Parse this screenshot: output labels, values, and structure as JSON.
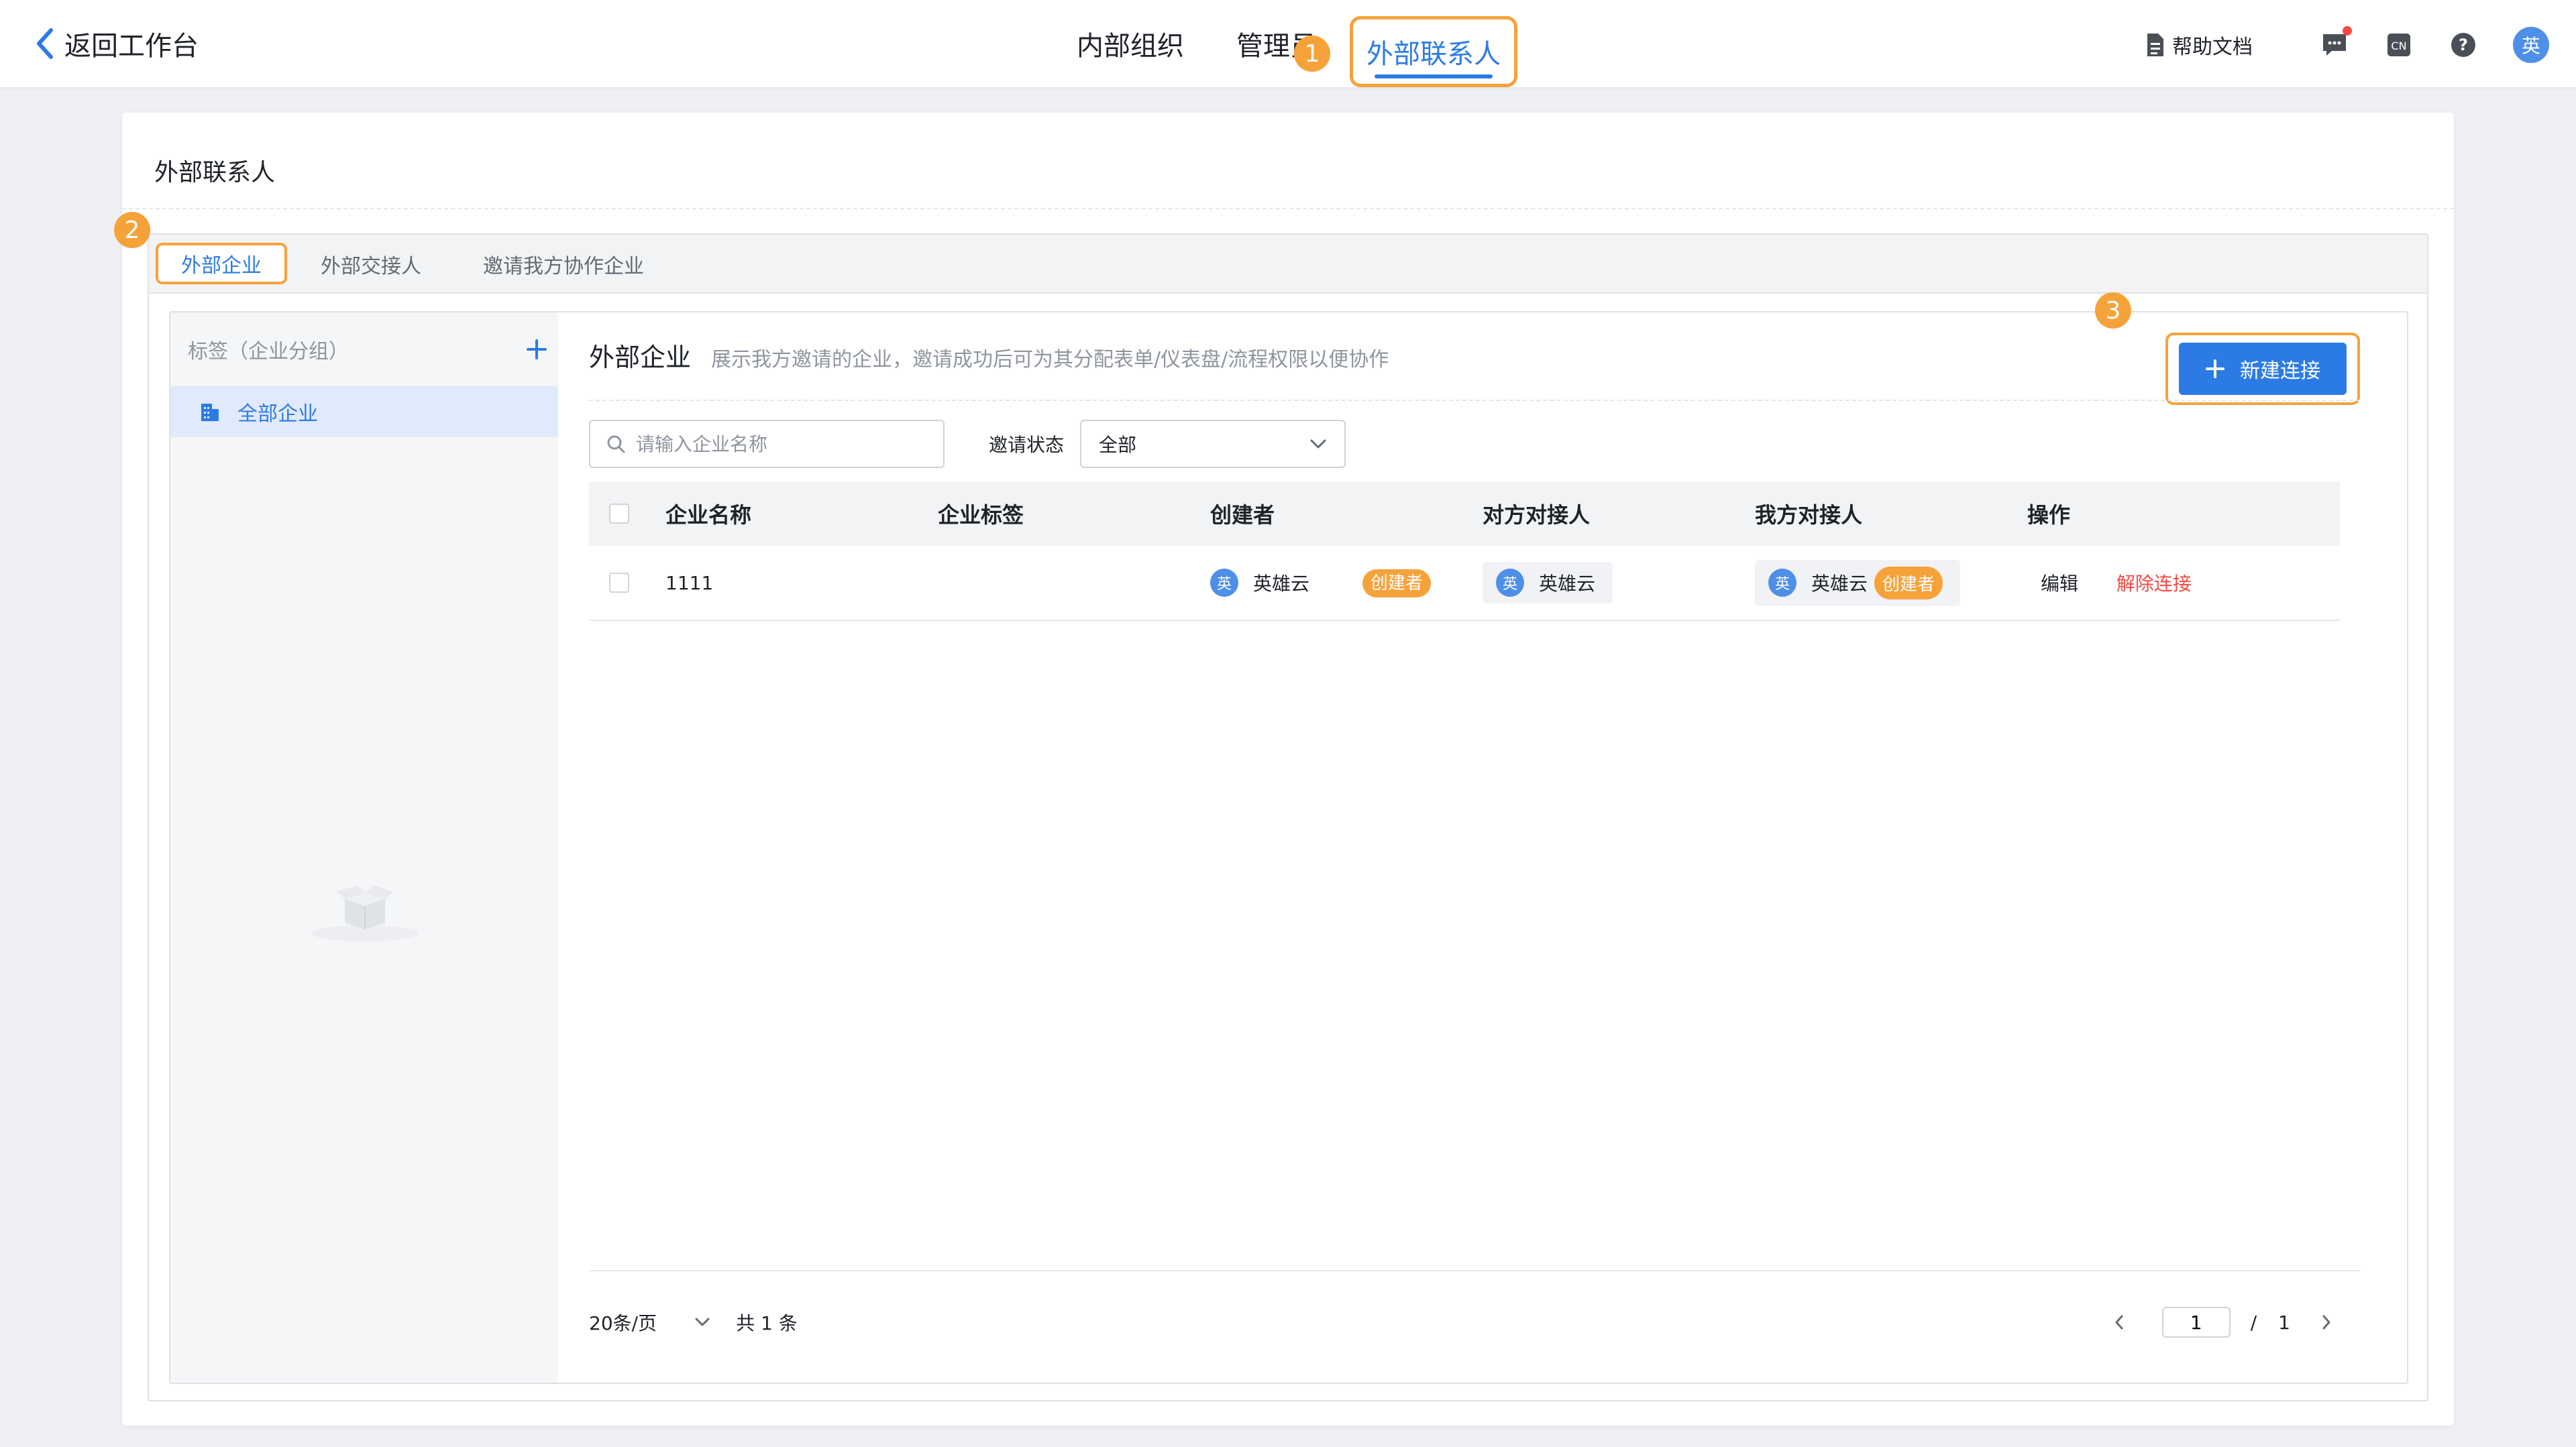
{
  "topbar": {
    "back_label": "返回工作台",
    "nav": {
      "internal": "内部组织",
      "admin": "管理员",
      "external": "外部联系人"
    },
    "help_doc": "帮助文档",
    "lang_icon_text": "CN",
    "help_icon_text": "?",
    "avatar_text": "英"
  },
  "badges": {
    "b1": "1",
    "b2": "2",
    "b3": "3"
  },
  "page": {
    "title": "外部联系人",
    "tabs": [
      "外部企业",
      "外部交接人",
      "邀请我方协作企业"
    ]
  },
  "sidebar": {
    "title": "标签（企业分组）",
    "item": "全部企业"
  },
  "content": {
    "title": "外部企业",
    "desc": "展示我方邀请的企业，邀请成功后可为其分配表单/仪表盘/流程权限以便协作",
    "new_button": "新建连接",
    "search_placeholder": "请输入企业名称",
    "status_label": "邀请状态",
    "status_value": "全部"
  },
  "table": {
    "headers": {
      "name": "企业名称",
      "tag": "企业标签",
      "creator": "创建者",
      "peer": "对方对接人",
      "mine": "我方对接人",
      "ops": "操作"
    },
    "rows": [
      {
        "name": "1111",
        "tag": "",
        "creator": "英雄云",
        "creator_avatar": "英",
        "creator_badge": "创建者",
        "peer": "英雄云",
        "peer_avatar": "英",
        "mine": "英雄云",
        "mine_avatar": "英",
        "mine_badge": "创建者",
        "op_edit": "编辑",
        "op_disconnect": "解除连接"
      }
    ]
  },
  "pager": {
    "page_size": "20条/页",
    "total": "共 1 条",
    "current": "1",
    "sep": "/",
    "pages": "1"
  },
  "colors": {
    "accent": "#2c7be5",
    "highlight": "#f6a23b",
    "danger": "#f54a45"
  }
}
